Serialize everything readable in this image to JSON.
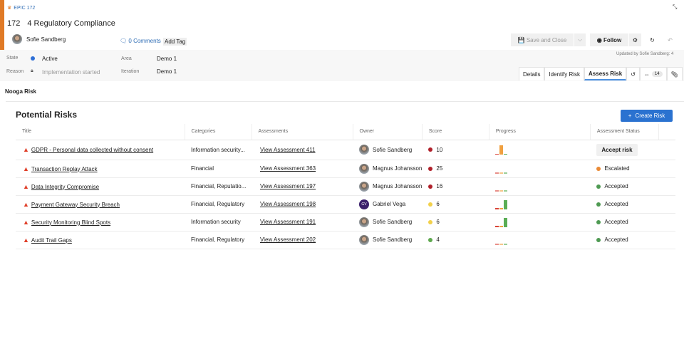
{
  "header": {
    "epic_label": "EPIC 172",
    "id": "172",
    "title": "4 Regulatory Compliance",
    "owner": "Sofie Sandberg",
    "comments": "0 Comments",
    "add_tag": "Add Tag",
    "save_close": "Save and Close",
    "follow": "Follow",
    "updated": "Updated by Sofie Sandberg: 4"
  },
  "fields": {
    "state_label": "State",
    "state": "Active",
    "reason_label": "Reason",
    "reason": "Implementation started",
    "area_label": "Area",
    "area": "Demo 1",
    "iteration_label": "Iteration",
    "iteration": "Demo 1",
    "state_color": "#2f6fd6"
  },
  "tabs": {
    "details": "Details",
    "identify": "Identify Risk",
    "assess": "Assess Risk",
    "links_count": "14"
  },
  "section": "Nooga Risk",
  "risks": {
    "heading": "Potential Risks",
    "create": "Create Risk",
    "columns": [
      "Title",
      "Categories",
      "Assessments",
      "Owner",
      "Score",
      "Progress",
      "Assessment Status"
    ],
    "rows": [
      {
        "title": "GDPR - Personal data collected without consent",
        "categories": "Information security...",
        "assessment": "View Assessment 411",
        "owner": "Sofie Sandberg",
        "score": "10",
        "score_color": "#b0202a",
        "progress": [
          0,
          1,
          0
        ],
        "status": "Accept risk",
        "status_type": "button"
      },
      {
        "title": "Transaction Replay Attack",
        "categories": "Financial",
        "assessment": "View Assessment 363",
        "owner": "Magnus Johansson",
        "score": "25",
        "score_color": "#b0202a",
        "progress": [
          0,
          0,
          0
        ],
        "status": "Escalated",
        "status_color": "#ea8a35"
      },
      {
        "title": "Data Integrity Compromise",
        "categories": "Financial, Reputatio...",
        "assessment": "View Assessment 197",
        "owner": "Magnus Johansson",
        "score": "16",
        "score_color": "#b0202a",
        "progress": [
          0,
          0,
          0
        ],
        "status": "Accepted",
        "status_color": "#4e9a52"
      },
      {
        "title": "Payment Gateway Security Breach",
        "categories": "Financial, Regulatory",
        "assessment": "View Assessment 198",
        "owner": "Gabriel Vega",
        "owner_initials": "GV",
        "score": "6",
        "score_color": "#f2d04a",
        "progress": [
          0,
          0,
          1
        ],
        "status": "Accepted",
        "status_color": "#4e9a52"
      },
      {
        "title": "Security Monitoring Blind Spots",
        "categories": "Information security",
        "assessment": "View Assessment 191",
        "owner": "Sofie Sandberg",
        "score": "6",
        "score_color": "#f2d04a",
        "progress": [
          0,
          0,
          1
        ],
        "status": "Accepted",
        "status_color": "#4e9a52"
      },
      {
        "title": "Audit Trail Gaps",
        "categories": "Financial, Regulatory",
        "assessment": "View Assessment 202",
        "owner": "Sofie Sandberg",
        "score": "4",
        "score_color": "#5ea84e",
        "progress": [
          0,
          0,
          0
        ],
        "status": "Accepted",
        "status_color": "#4e9a52"
      }
    ]
  }
}
